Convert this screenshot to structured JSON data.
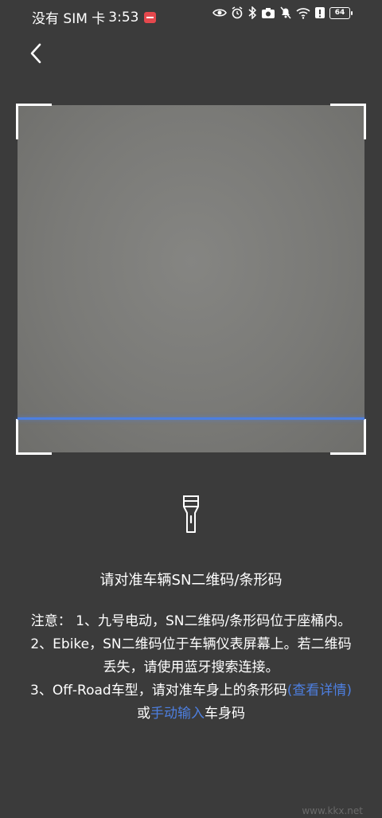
{
  "status_bar": {
    "carrier": "没有 SIM 卡",
    "time": "3:53",
    "battery": "64",
    "icons": [
      "eye-icon",
      "alarm-icon",
      "bluetooth-icon",
      "camera-icon",
      "mute-icon",
      "wifi-icon",
      "alert-icon",
      "battery-icon"
    ]
  },
  "nav": {
    "back_icon": "chevron-left-icon"
  },
  "scanner": {
    "accent_color": "#4d7fe0",
    "flashlight_icon": "flashlight-icon"
  },
  "instruction": "请对准车辆SN二维码/条形码",
  "notes": {
    "line1": "注意： 1、九号电动，SN二维码/条形码位于座桶内。 2、Ebike，SN二维码位于车辆仪表屏幕上。若二维码丢失，请使用蓝牙搜索连接。",
    "line3_prefix": "3、Off-Road车型，请对准车身上的条形码",
    "view_details_link": "(查看详情)",
    "or": "或",
    "manual_input_link": "手动输入",
    "suffix": "车身码"
  },
  "watermark": "www.kkx.net"
}
